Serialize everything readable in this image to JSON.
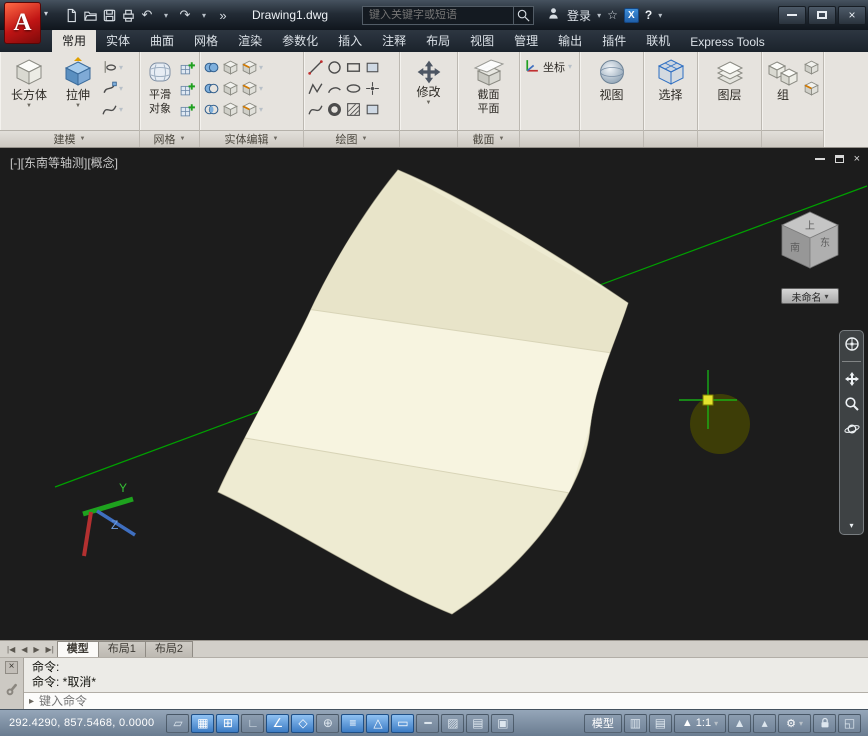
{
  "icons": {
    "dropdown_small": "▾",
    "panel_arrow": "▼",
    "more": "»",
    "undo": "↶",
    "redo": "↷",
    "star": "☆",
    "close": "×",
    "nav_first": "|◀",
    "nav_prev": "◀",
    "nav_next": "▶",
    "nav_last": "▶|",
    "prompt": "▸",
    "gear": "⚙",
    "clean_screen": "◱",
    "annotation_visibility": "▲",
    "annotation_autoscale": "▴"
  },
  "colors": {
    "titlebar": "#232c36",
    "ribbon_bg": "#e6e3de",
    "canvas_bg": "#1c1c1c",
    "surface_cream": "#f0ecd2",
    "axis_green": "#00a000",
    "crosshair_green": "#17c517",
    "status_active_blue": "#3c7cc4",
    "logo_red": "#c01414"
  },
  "titlebar": {
    "logo_letter": "A",
    "title": "Drawing1.dwg",
    "search_placeholder": "键入关键字或短语",
    "signin_label": "登录",
    "exchange_letter": "X",
    "help_label": "?"
  },
  "ribbon": {
    "tabs": [
      {
        "label": "常用",
        "active": true
      },
      {
        "label": "实体"
      },
      {
        "label": "曲面"
      },
      {
        "label": "网格"
      },
      {
        "label": "渲染"
      },
      {
        "label": "参数化"
      },
      {
        "label": "插入"
      },
      {
        "label": "注释"
      },
      {
        "label": "布局"
      },
      {
        "label": "视图"
      },
      {
        "label": "管理"
      },
      {
        "label": "输出"
      },
      {
        "label": "插件"
      },
      {
        "label": "联机"
      },
      {
        "label": "Express Tools"
      }
    ],
    "panels": {
      "modeling": {
        "label": "建模",
        "box": "长方体",
        "extrude": "拉伸"
      },
      "mesh": {
        "label": "网格",
        "smooth_line1": "平滑",
        "smooth_line2": "对象"
      },
      "solid_editing": {
        "label": "实体编辑"
      },
      "draw": {
        "label": "绘图"
      },
      "modify": {
        "button": "修改"
      },
      "section": {
        "label": "截面",
        "plane_line1": "截面",
        "plane_line2": "平面"
      },
      "coordinates": {
        "label": "坐标"
      },
      "view": {
        "button": "视图"
      },
      "selection": {
        "button": "选择"
      },
      "layers": {
        "button": "图层"
      },
      "groups": {
        "button": "组"
      }
    }
  },
  "viewport": {
    "label": "[-][东南等轴测][概念]",
    "viewcube": {
      "top": "上",
      "left": "南",
      "right": "东",
      "unnamed": "未命名"
    },
    "ucs": {
      "y": "Y",
      "z": "Z"
    }
  },
  "layout_tabs": {
    "tabs": [
      {
        "label": "模型",
        "active": true
      },
      {
        "label": "布局1"
      },
      {
        "label": "布局2"
      }
    ]
  },
  "command": {
    "history": [
      {
        "text": "命令:"
      },
      {
        "text": "命令: *取消*"
      }
    ],
    "input_placeholder": "键入命令"
  },
  "statusbar": {
    "coordinates": "292.4290, 857.5468, 0.0000",
    "toggles": [
      {
        "name": "infer-constraints-toggle",
        "glyph": "▱",
        "active": false
      },
      {
        "name": "snap-mode-toggle",
        "glyph": "▦",
        "active": true
      },
      {
        "name": "grid-display-toggle",
        "glyph": "⊞",
        "active": true
      },
      {
        "name": "ortho-mode-toggle",
        "glyph": "∟",
        "active": false
      },
      {
        "name": "pol建ar-tracking-toggle",
        "glyph": "∠",
        "active": true
      },
      {
        "name": "object-snap-toggle",
        "glyph": "◇",
        "active": true
      },
      {
        "name": "3d-object-snap-toggle",
        "glyph": "⊕",
        "active": false
      },
      {
        "name": "object-snap-tracking-toggle",
        "glyph": "≡",
        "active": true
      },
      {
        "name": "dynamic-ucs-toggle",
        "glyph": "△",
        "active": true
      },
      {
        "name": "dynamic-input-toggle",
        "glyph": "▭",
        "active": true
      },
      {
        "name": "lineweight-toggle",
        "glyph": "━",
        "active": false
      },
      {
        "name": "transparency-toggle",
        "glyph": "▨",
        "active": false
      },
      {
        "name": "quick-properties-toggle",
        "glyph": "▤",
        "active": false
      },
      {
        "name": "selection-cycling-toggle",
        "glyph": "▣",
        "active": false
      }
    ],
    "model_label": "模型",
    "right_toggles": [
      {
        "name": "quick-view-layouts-button",
        "glyph": "▥",
        "active": false
      },
      {
        "name": "quick-view-drawings-button",
        "glyph": "▤",
        "active": false
      }
    ],
    "annotation_scale": "1:1"
  }
}
